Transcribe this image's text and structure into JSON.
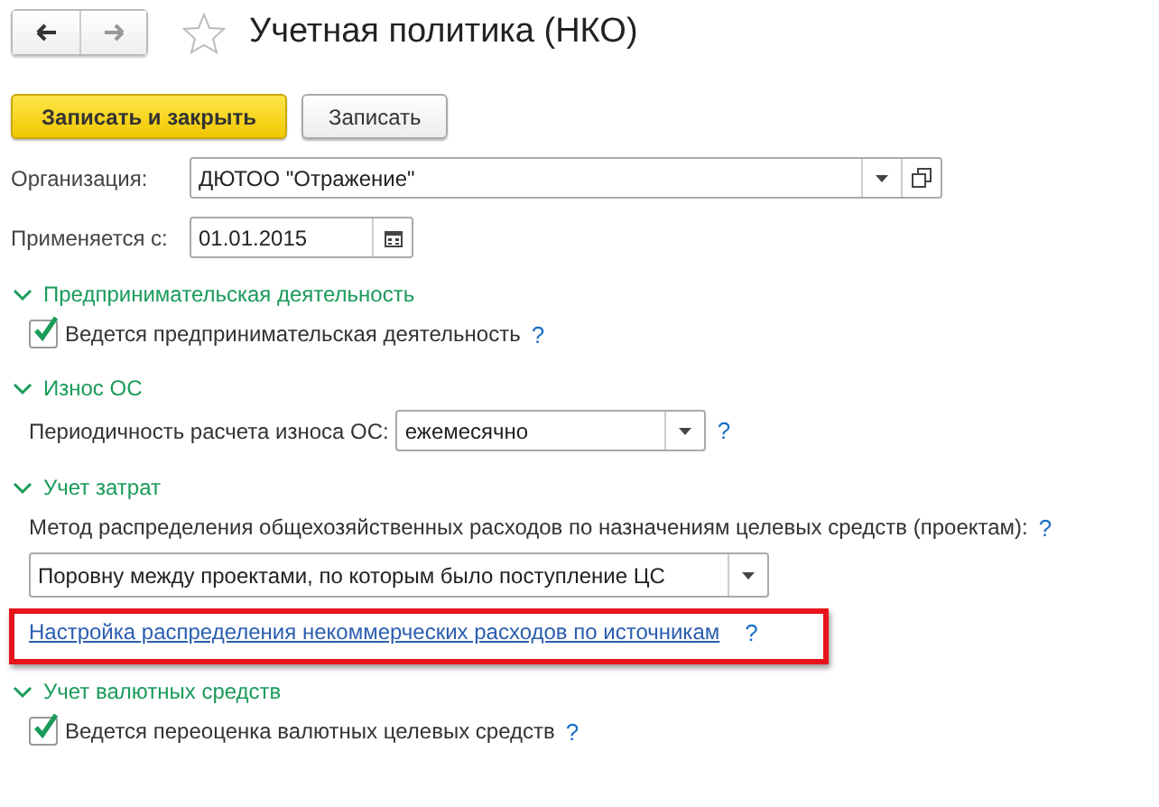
{
  "title": "Учетная политика (НКО)",
  "favorite": false,
  "buttons": [
    {
      "label": "Записать и закрыть",
      "kind": "primary"
    },
    {
      "label": "Записать",
      "kind": "default"
    }
  ],
  "fields": [
    {
      "label": "Организация:",
      "value": "ДЮТОО \"Отражение\"",
      "kind": "reference"
    },
    {
      "label": "Применяется с:",
      "value": "01.01.2015",
      "kind": "date"
    }
  ],
  "sections": [
    {
      "title": "Предпринимательская деятельность",
      "expanded": true,
      "items": [
        {
          "kind": "checkbox",
          "label": "Ведется предпринимательская деятельность",
          "checked": true,
          "help": "?"
        }
      ]
    },
    {
      "title": "Износ ОС",
      "expanded": true,
      "items": [
        {
          "kind": "select",
          "label": "Периодичность расчета износа ОС:",
          "value": "ежемесячно",
          "help": "?"
        }
      ]
    },
    {
      "title": "Учет затрат",
      "expanded": true,
      "items": [
        {
          "kind": "caption",
          "label": "Метод распределения общехозяйственных расходов по назначениям целевых средств (проектам):",
          "help": "?"
        },
        {
          "kind": "select",
          "value": "Поровну между проектами, по которым было поступление ЦС"
        },
        {
          "kind": "link",
          "label": "Настройка распределения некоммерческих расходов по источникам",
          "help": "?",
          "highlighted": true
        }
      ]
    },
    {
      "title": "Учет валютных средств",
      "expanded": true,
      "items": [
        {
          "kind": "checkbox",
          "label": "Ведется переоценка валютных целевых средств",
          "checked": true,
          "help": "?"
        }
      ]
    }
  ]
}
